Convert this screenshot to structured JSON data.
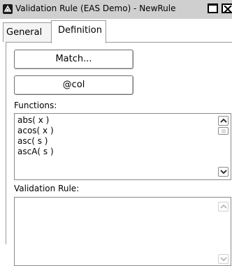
{
  "window": {
    "title": "Validation Rule (EAS Demo) - NewRule",
    "app_icon": "app-icon"
  },
  "tabs": [
    {
      "label": "General",
      "selected": false
    },
    {
      "label": "Definition",
      "selected": true
    }
  ],
  "buttons": {
    "match_label": "Match...",
    "col_label": "@col"
  },
  "functions": {
    "label": "Functions:",
    "items": [
      "abs( x )",
      "acos( x )",
      "asc( s )",
      "ascA( s )"
    ]
  },
  "validation_rule": {
    "label": "Validation Rule:",
    "value": ""
  }
}
